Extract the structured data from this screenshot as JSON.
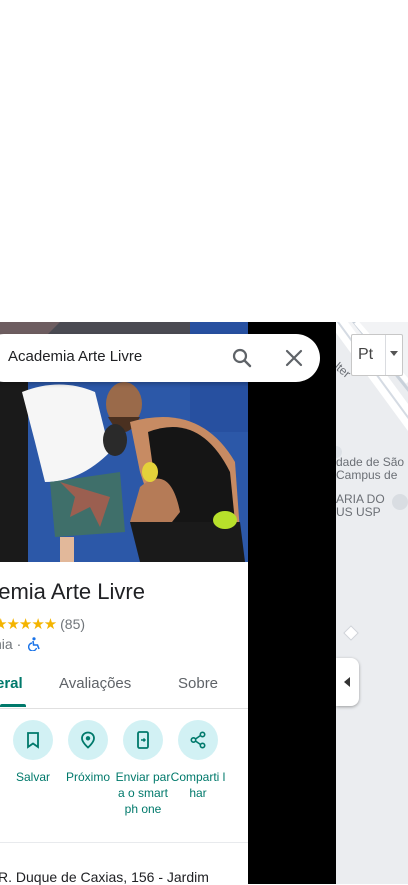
{
  "search": {
    "query": "Academia Arte Livre"
  },
  "place": {
    "title": "demia Arte Livre",
    "stars": "★★★★★",
    "review_count": "(85)",
    "category": "nia ·",
    "accessible_icon": "wheelchair-icon"
  },
  "tabs": [
    {
      "label": "eral",
      "active": true
    },
    {
      "label": "Avaliações",
      "active": false
    },
    {
      "label": "Sobre",
      "active": false
    }
  ],
  "actions": [
    {
      "label": "Salvar",
      "icon": "bookmark-icon"
    },
    {
      "label": "Próximo",
      "icon": "nearby-icon"
    },
    {
      "label": "Enviar para o smartph one",
      "icon": "send-to-phone-icon"
    },
    {
      "label": "Comparti lhar",
      "icon": "share-icon"
    }
  ],
  "address": "R. Duque de Caxias, 156 - Jardim",
  "map": {
    "lang_button": "Pt",
    "labels": [
      "lter",
      "dade de São",
      "Campus de",
      "ARIA DO",
      "US USP"
    ]
  },
  "colors": {
    "accent": "#00796b",
    "action_bg": "#d2f1f4",
    "star": "#f4b400"
  }
}
